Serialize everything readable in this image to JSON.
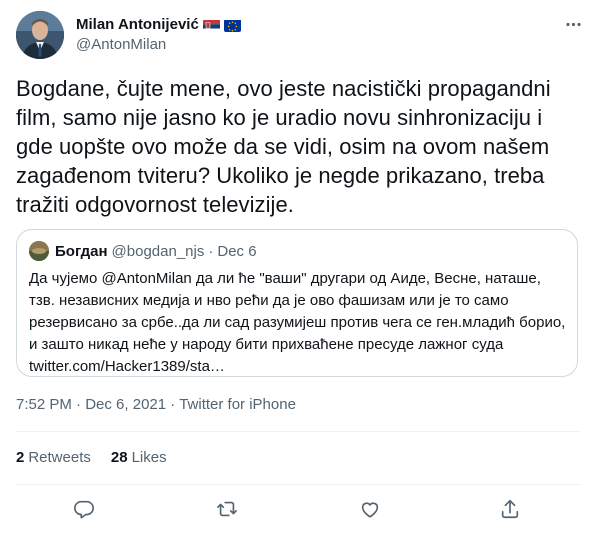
{
  "author": {
    "display_name": "Milan Antonijević",
    "handle": "@AntonMilan",
    "flags": [
      "serbia-flag",
      "eu-flag"
    ]
  },
  "tweet": {
    "text": "Bogdane, čujte mene, ovo jeste nacistički propagandni film, samo nije jasno ko je uradio novu sinhronizaciju i gde uopšte ovo može da se vidi, osim na ovom našem zagađenom tviteru? Ukoliko je negde prikazano, treba tražiti odgovornost televizije."
  },
  "quoted": {
    "display_name": "Богдан",
    "handle": "@bogdan_njs",
    "separator": "·",
    "date": "Dec 6",
    "text": "Да чујемо @AntonMilan да ли ће \"ваши\" другари од Аиде, Весне, наташе, тзв. независних медија и нво рећи да је ово фашизам или је то само резервисано за србе..да ли сад разумијеш против чега се ген.младић борио, и зашто никад неће у народу бити прихваћене пресуде лажног суда twitter.com/Hacker1389/sta…"
  },
  "meta": {
    "time": "7:52 PM",
    "separator1": "·",
    "date": "Dec 6, 2021",
    "separator2": "·",
    "source": "Twitter for iPhone"
  },
  "stats": {
    "retweets_count": "2",
    "retweets_label": "Retweets",
    "likes_count": "28",
    "likes_label": "Likes"
  },
  "actions": {
    "icons": [
      "reply-icon",
      "retweet-icon",
      "like-icon",
      "share-icon"
    ]
  },
  "colors": {
    "text_primary": "#0f1419",
    "text_secondary": "#536471",
    "border": "#cfd9de",
    "divider": "#eff3f4"
  }
}
